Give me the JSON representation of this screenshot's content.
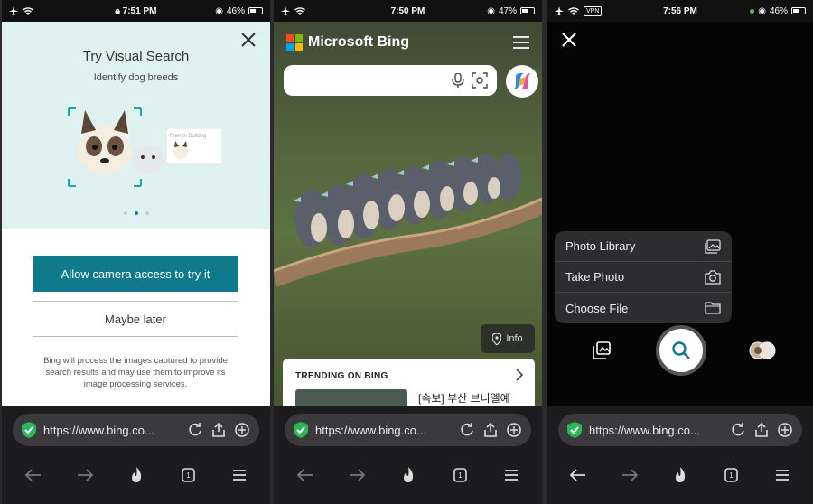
{
  "panel1": {
    "status": {
      "time": "7:51 PM",
      "battery": "46%"
    },
    "title": "Try Visual Search",
    "subtitle": "Identify dog breeds",
    "overlay_label": "French Bulldog",
    "allow_button": "Allow camera access to try it",
    "later_button": "Maybe later",
    "disclaimer": "Bing will process the images captured to provide search results and may use them to improve its image processing services.",
    "url": "https://www.bing.co..."
  },
  "panel2": {
    "status": {
      "time": "7:50 PM",
      "battery": "47%"
    },
    "brand": "Microsoft Bing",
    "search_placeholder": "",
    "info_label": "Info",
    "trending_heading": "TRENDING ON BING",
    "trending_item": "[속보] 부산 브니엘예",
    "url": "https://www.bing.co..."
  },
  "panel3": {
    "status": {
      "time": "7:56 PM",
      "battery": "46%",
      "vpn": "VPN"
    },
    "menu": [
      {
        "label": "Photo Library",
        "icon": "photo-library-icon"
      },
      {
        "label": "Take Photo",
        "icon": "camera-icon"
      },
      {
        "label": "Choose File",
        "icon": "folder-icon"
      }
    ],
    "url": "https://www.bing.co..."
  },
  "chrome": {
    "tab_count": "1"
  },
  "colors": {
    "accent": "#0e7a8c",
    "chrome_bg": "#1c1c1e",
    "urlbar_bg": "#3a3a3c",
    "mint": "#dff2f0"
  }
}
